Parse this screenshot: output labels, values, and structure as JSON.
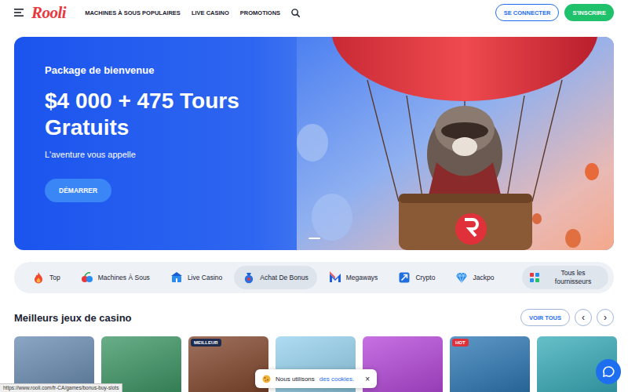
{
  "header": {
    "logo": "Rooli",
    "nav": [
      "MACHINES À SOUS POPULAIRES",
      "LIVE CASINO",
      "PROMOTIONS"
    ],
    "login": "SE CONNECTER",
    "signup": "S'INSCRIRE"
  },
  "hero": {
    "kicker": "Package de bienvenue",
    "title": "$4 000 + 475 Tours Gratuits",
    "subtitle": "L'aventure vous appelle",
    "button": "DÉMARRER",
    "slides": [
      {
        "selected": true
      }
    ]
  },
  "categories": {
    "items": [
      {
        "label": "Top",
        "selected": false
      },
      {
        "label": "Machines À Sous",
        "selected": false
      },
      {
        "label": "Live Casino",
        "selected": false
      },
      {
        "label": "Achat De Bonus",
        "selected": true
      },
      {
        "label": "Megaways",
        "selected": false
      },
      {
        "label": "Crypto",
        "selected": false
      },
      {
        "label": "Jackpo",
        "selected": false
      }
    ],
    "all_providers": "Tous les fournisseurs"
  },
  "section": {
    "title": "Meilleurs jeux de casino",
    "view_all": "VOIR TOUS",
    "prev": "‹",
    "next": "›"
  },
  "games": [
    {
      "color": "#5f84ad"
    },
    {
      "color": "#2f8f5a"
    },
    {
      "color": "#7a3a1e",
      "badge": {
        "text": "MEILLEUR",
        "color": "#1d2b4f"
      }
    },
    {
      "color": "#8fd0ee"
    },
    {
      "color": "#b03ad8"
    },
    {
      "color": "#1f6fb0",
      "badge": {
        "text": "HOT",
        "color": "#e0303a"
      }
    },
    {
      "color": "#2aa7b5"
    }
  ],
  "cookie": {
    "text": "Nous utilisons",
    "link": "des cookies.",
    "close": "×"
  },
  "status_bar": {
    "url": "https://www.rooli.com/fr-CA/games/bonus-buy-slots"
  }
}
